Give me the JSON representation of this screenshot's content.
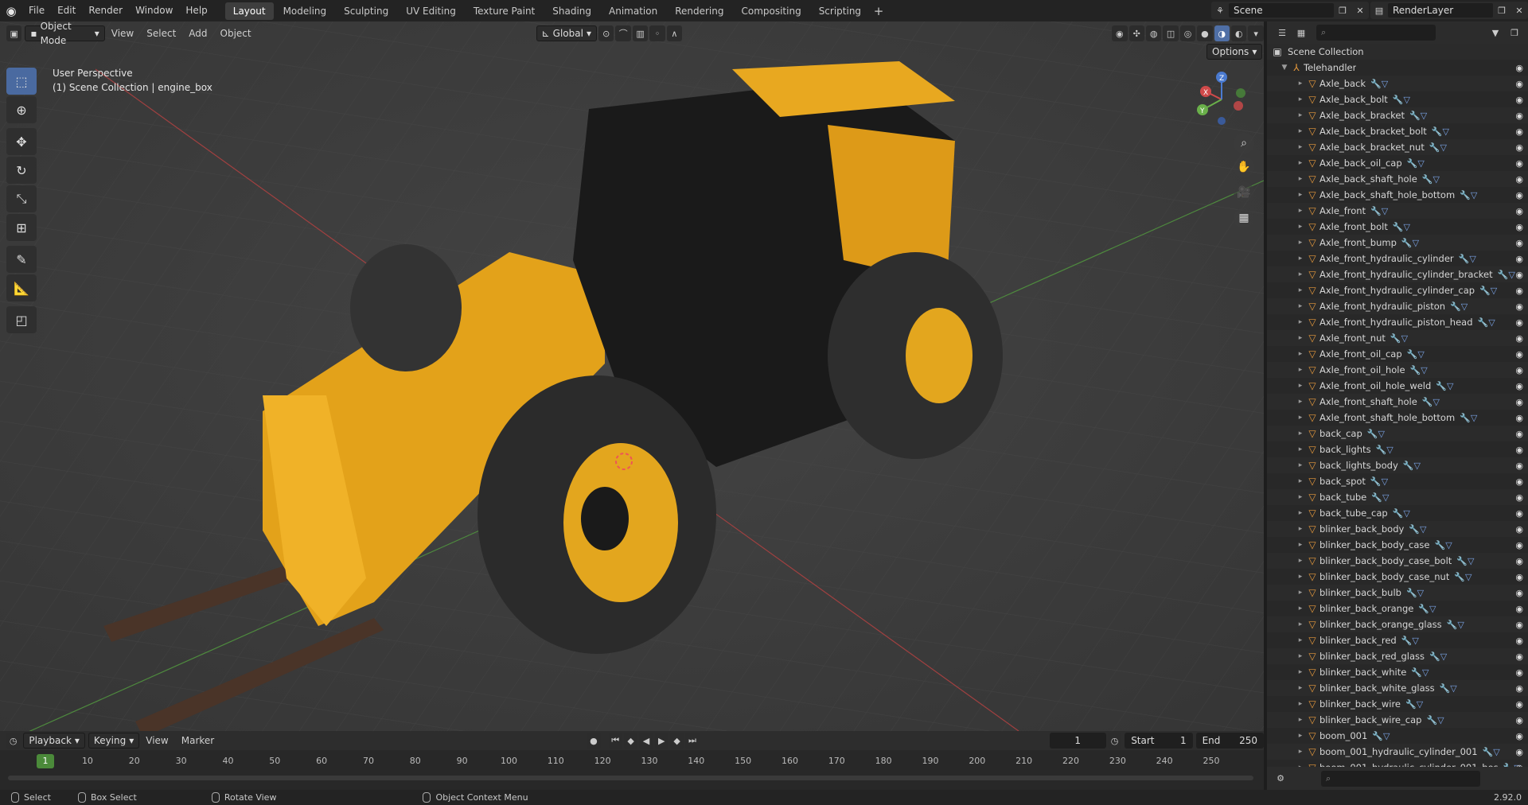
{
  "topbar": {
    "menus": [
      "File",
      "Edit",
      "Render",
      "Window",
      "Help"
    ],
    "workspaces": [
      "Layout",
      "Modeling",
      "Sculpting",
      "UV Editing",
      "Texture Paint",
      "Shading",
      "Animation",
      "Rendering",
      "Compositing",
      "Scripting"
    ],
    "active_workspace": "Layout",
    "scene_label": "Scene",
    "layer_label": "RenderLayer"
  },
  "viewport": {
    "mode": "Object Mode",
    "menus": [
      "View",
      "Select",
      "Add",
      "Object"
    ],
    "transform_orientation": "Global",
    "options_label": "Options",
    "perspective_label": "User Perspective",
    "context_label": "(1) Scene Collection | engine_box",
    "gizmo_axes": [
      "X",
      "Y",
      "Z"
    ]
  },
  "outliner": {
    "root": "Scene Collection",
    "collection": "Telehandler",
    "items": [
      "Axle_back",
      "Axle_back_bolt",
      "Axle_back_bracket",
      "Axle_back_bracket_bolt",
      "Axle_back_bracket_nut",
      "Axle_back_oil_cap",
      "Axle_back_shaft_hole",
      "Axle_back_shaft_hole_bottom",
      "Axle_front",
      "Axle_front_bolt",
      "Axle_front_bump",
      "Axle_front_hydraulic_cylinder",
      "Axle_front_hydraulic_cylinder_bracket",
      "Axle_front_hydraulic_cylinder_cap",
      "Axle_front_hydraulic_piston",
      "Axle_front_hydraulic_piston_head",
      "Axle_front_nut",
      "Axle_front_oil_cap",
      "Axle_front_oil_hole",
      "Axle_front_oil_hole_weld",
      "Axle_front_shaft_hole",
      "Axle_front_shaft_hole_bottom",
      "back_cap",
      "back_lights",
      "back_lights_body",
      "back_spot",
      "back_tube",
      "back_tube_cap",
      "blinker_back_body",
      "blinker_back_body_case",
      "blinker_back_body_case_bolt",
      "blinker_back_body_case_nut",
      "blinker_back_bulb",
      "blinker_back_orange",
      "blinker_back_orange_glass",
      "blinker_back_red",
      "blinker_back_red_glass",
      "blinker_back_white",
      "blinker_back_white_glass",
      "blinker_back_wire",
      "blinker_back_wire_cap",
      "boom_001",
      "boom_001_hydraulic_cylinder_001",
      "boom_001_hydraulic_cylinder_001_hos"
    ]
  },
  "timeline": {
    "menus": [
      "Playback",
      "Keying",
      "View",
      "Marker"
    ],
    "current_frame": "1",
    "start_label": "Start",
    "start_value": "1",
    "end_label": "End",
    "end_value": "250",
    "ruler": [
      "1",
      "10",
      "20",
      "30",
      "40",
      "50",
      "60",
      "70",
      "80",
      "90",
      "100",
      "110",
      "120",
      "130",
      "140",
      "150",
      "160",
      "170",
      "180",
      "190",
      "200",
      "210",
      "220",
      "230",
      "240",
      "250"
    ]
  },
  "statusbar": {
    "select": "Select",
    "box_select": "Box Select",
    "rotate_view": "Rotate View",
    "context_menu": "Object Context Menu",
    "version": "2.92.0"
  }
}
